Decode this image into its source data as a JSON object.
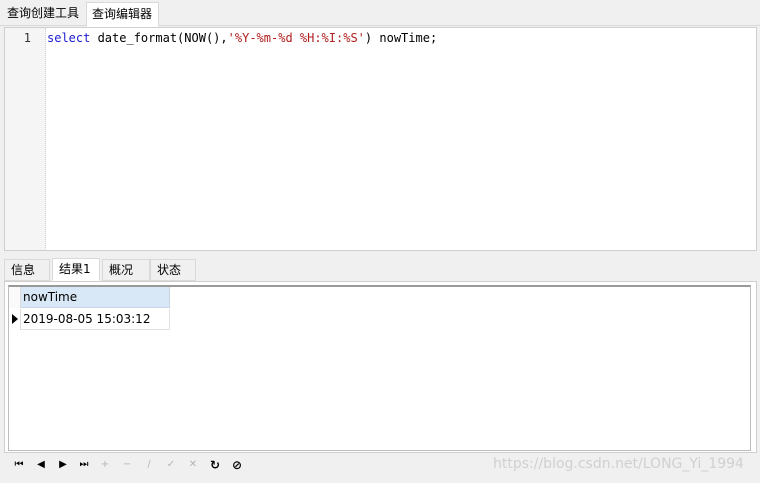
{
  "top_tabs": [
    {
      "label": "查询创建工具"
    },
    {
      "label": "查询编辑器"
    }
  ],
  "editor": {
    "line_number": "1",
    "code": {
      "keyword": "select",
      "before_string": " date_format(NOW(),",
      "string": "'%Y-%m-%d %H:%I:%S'",
      "after_string": ") nowTime;"
    }
  },
  "result_tabs": [
    {
      "label": "信息"
    },
    {
      "label": "结果1"
    },
    {
      "label": "概况"
    },
    {
      "label": "状态"
    }
  ],
  "grid": {
    "columns": [
      "nowTime"
    ],
    "rows": [
      [
        "2019-08-05 15:03:12"
      ]
    ]
  },
  "navigator": {
    "first_glyph": "⏮",
    "prev_glyph": "◀",
    "next_glyph": "▶",
    "last_glyph": "⏭",
    "add_glyph": "+",
    "delete_glyph": "−",
    "edit_glyph": "∕",
    "apply_glyph": "✓",
    "cancel_glyph": "✕",
    "refresh_glyph": "↻",
    "stop_glyph": "⊘"
  },
  "watermark": "https://blog.csdn.net/LONG_Yi_1994"
}
